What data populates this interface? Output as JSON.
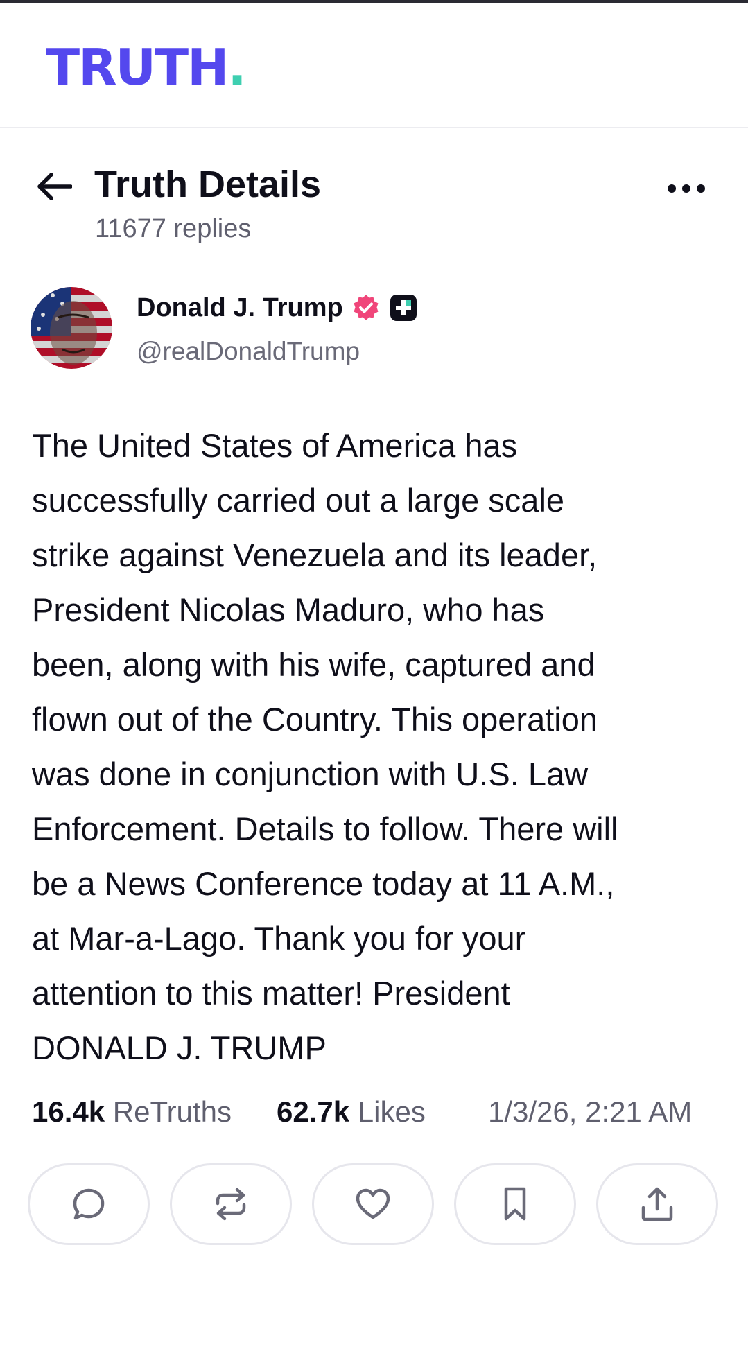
{
  "app": {
    "logo_text": "TRUTH",
    "logo_dot": ".",
    "brand_color": "#5448ee",
    "accent_color": "#3ecfb0"
  },
  "header": {
    "back_icon": "arrow-left-icon",
    "title": "Truth Details",
    "replies": "11677 replies",
    "more_icon": "more-horizontal-icon"
  },
  "author": {
    "name": "Donald J. Trump",
    "handle": "@realDonaldTrump",
    "verified_icon": "verified-badge-icon",
    "verified_color": "#f0467a",
    "plus_icon": "truth-plus-badge-icon"
  },
  "post": {
    "lines": [
      "The United States of America has",
      "successfully carried out a large scale",
      "strike against Venezuela and its leader,",
      "President Nicolas Maduro, who has",
      "been, along with his wife, captured and",
      "flown out of the Country. This operation",
      "was done in conjunction with U.S. Law",
      "Enforcement. Details to follow. There will",
      "be a News Conference today at 11 A.M.,",
      "at Mar-a-Lago. Thank you for your",
      "attention to this matter! President",
      "DONALD J. TRUMP"
    ]
  },
  "stats": {
    "retruths_count": "16.4k",
    "retruths_label": "ReTruths",
    "likes_count": "62.7k",
    "likes_label": "Likes",
    "timestamp": "1/3/26, 2:21 AM"
  },
  "actions": [
    {
      "name": "reply",
      "icon": "comment-icon"
    },
    {
      "name": "retruth",
      "icon": "repost-icon"
    },
    {
      "name": "like",
      "icon": "heart-icon"
    },
    {
      "name": "bookmark",
      "icon": "bookmark-icon"
    },
    {
      "name": "share",
      "icon": "share-icon"
    }
  ]
}
